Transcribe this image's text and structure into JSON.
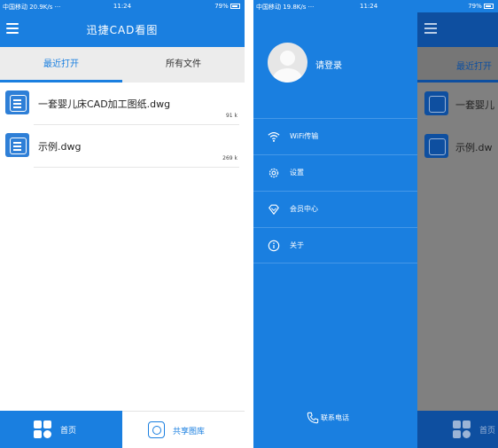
{
  "status_bar_left": {
    "carrier": "中国移动 20.9K/s ···",
    "time": "11:24",
    "battery": "79%"
  },
  "status_bar_right": {
    "carrier": "中国移动 19.8K/s ···",
    "time": "11:24",
    "battery": "79%"
  },
  "app": {
    "title": "迅捷CAD看图",
    "tabs": [
      {
        "label": "最近打开",
        "active": true
      },
      {
        "label": "所有文件",
        "active": false
      }
    ],
    "files": [
      {
        "name": "一套婴儿床CAD加工图纸.dwg",
        "size": "91 k"
      },
      {
        "name": "示例.dwg",
        "size": "269 k"
      }
    ],
    "bottom_nav": {
      "home_label": "首页",
      "share_label": "共享图库"
    }
  },
  "drawer": {
    "user_name": "请登录",
    "menu": [
      {
        "label": "WiFi传输",
        "icon": "wifi-icon"
      },
      {
        "label": "设置",
        "icon": "gear-icon"
      },
      {
        "label": "会员中心",
        "icon": "diamond-icon"
      },
      {
        "label": "关于",
        "icon": "info-icon"
      }
    ],
    "contact_label": "联系电话"
  },
  "background_app": {
    "tab_label": "最近打开",
    "file_1": "一套婴儿",
    "file_2": "示例.dw",
    "home_label": "首页"
  },
  "colors": {
    "primary": "#1a7fe0",
    "dimmed_primary": "#0e4fa0",
    "tab_bg": "#ececec"
  }
}
